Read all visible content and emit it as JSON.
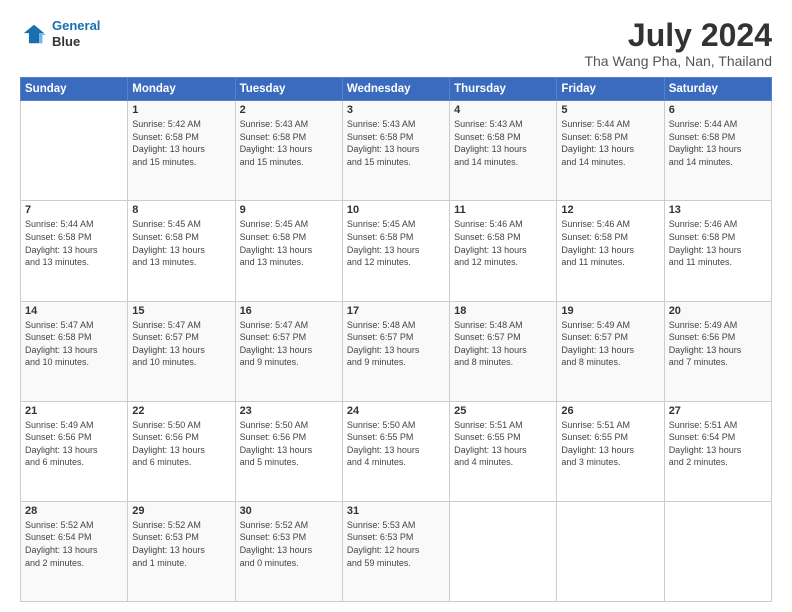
{
  "header": {
    "logo_line1": "General",
    "logo_line2": "Blue",
    "month_year": "July 2024",
    "location": "Tha Wang Pha, Nan, Thailand"
  },
  "days_of_week": [
    "Sunday",
    "Monday",
    "Tuesday",
    "Wednesday",
    "Thursday",
    "Friday",
    "Saturday"
  ],
  "weeks": [
    [
      {
        "day": "",
        "info": ""
      },
      {
        "day": "1",
        "info": "Sunrise: 5:42 AM\nSunset: 6:58 PM\nDaylight: 13 hours\nand 15 minutes."
      },
      {
        "day": "2",
        "info": "Sunrise: 5:43 AM\nSunset: 6:58 PM\nDaylight: 13 hours\nand 15 minutes."
      },
      {
        "day": "3",
        "info": "Sunrise: 5:43 AM\nSunset: 6:58 PM\nDaylight: 13 hours\nand 15 minutes."
      },
      {
        "day": "4",
        "info": "Sunrise: 5:43 AM\nSunset: 6:58 PM\nDaylight: 13 hours\nand 14 minutes."
      },
      {
        "day": "5",
        "info": "Sunrise: 5:44 AM\nSunset: 6:58 PM\nDaylight: 13 hours\nand 14 minutes."
      },
      {
        "day": "6",
        "info": "Sunrise: 5:44 AM\nSunset: 6:58 PM\nDaylight: 13 hours\nand 14 minutes."
      }
    ],
    [
      {
        "day": "7",
        "info": "Sunrise: 5:44 AM\nSunset: 6:58 PM\nDaylight: 13 hours\nand 13 minutes."
      },
      {
        "day": "8",
        "info": "Sunrise: 5:45 AM\nSunset: 6:58 PM\nDaylight: 13 hours\nand 13 minutes."
      },
      {
        "day": "9",
        "info": "Sunrise: 5:45 AM\nSunset: 6:58 PM\nDaylight: 13 hours\nand 13 minutes."
      },
      {
        "day": "10",
        "info": "Sunrise: 5:45 AM\nSunset: 6:58 PM\nDaylight: 13 hours\nand 12 minutes."
      },
      {
        "day": "11",
        "info": "Sunrise: 5:46 AM\nSunset: 6:58 PM\nDaylight: 13 hours\nand 12 minutes."
      },
      {
        "day": "12",
        "info": "Sunrise: 5:46 AM\nSunset: 6:58 PM\nDaylight: 13 hours\nand 11 minutes."
      },
      {
        "day": "13",
        "info": "Sunrise: 5:46 AM\nSunset: 6:58 PM\nDaylight: 13 hours\nand 11 minutes."
      }
    ],
    [
      {
        "day": "14",
        "info": "Sunrise: 5:47 AM\nSunset: 6:58 PM\nDaylight: 13 hours\nand 10 minutes."
      },
      {
        "day": "15",
        "info": "Sunrise: 5:47 AM\nSunset: 6:57 PM\nDaylight: 13 hours\nand 10 minutes."
      },
      {
        "day": "16",
        "info": "Sunrise: 5:47 AM\nSunset: 6:57 PM\nDaylight: 13 hours\nand 9 minutes."
      },
      {
        "day": "17",
        "info": "Sunrise: 5:48 AM\nSunset: 6:57 PM\nDaylight: 13 hours\nand 9 minutes."
      },
      {
        "day": "18",
        "info": "Sunrise: 5:48 AM\nSunset: 6:57 PM\nDaylight: 13 hours\nand 8 minutes."
      },
      {
        "day": "19",
        "info": "Sunrise: 5:49 AM\nSunset: 6:57 PM\nDaylight: 13 hours\nand 8 minutes."
      },
      {
        "day": "20",
        "info": "Sunrise: 5:49 AM\nSunset: 6:56 PM\nDaylight: 13 hours\nand 7 minutes."
      }
    ],
    [
      {
        "day": "21",
        "info": "Sunrise: 5:49 AM\nSunset: 6:56 PM\nDaylight: 13 hours\nand 6 minutes."
      },
      {
        "day": "22",
        "info": "Sunrise: 5:50 AM\nSunset: 6:56 PM\nDaylight: 13 hours\nand 6 minutes."
      },
      {
        "day": "23",
        "info": "Sunrise: 5:50 AM\nSunset: 6:56 PM\nDaylight: 13 hours\nand 5 minutes."
      },
      {
        "day": "24",
        "info": "Sunrise: 5:50 AM\nSunset: 6:55 PM\nDaylight: 13 hours\nand 4 minutes."
      },
      {
        "day": "25",
        "info": "Sunrise: 5:51 AM\nSunset: 6:55 PM\nDaylight: 13 hours\nand 4 minutes."
      },
      {
        "day": "26",
        "info": "Sunrise: 5:51 AM\nSunset: 6:55 PM\nDaylight: 13 hours\nand 3 minutes."
      },
      {
        "day": "27",
        "info": "Sunrise: 5:51 AM\nSunset: 6:54 PM\nDaylight: 13 hours\nand 2 minutes."
      }
    ],
    [
      {
        "day": "28",
        "info": "Sunrise: 5:52 AM\nSunset: 6:54 PM\nDaylight: 13 hours\nand 2 minutes."
      },
      {
        "day": "29",
        "info": "Sunrise: 5:52 AM\nSunset: 6:53 PM\nDaylight: 13 hours\nand 1 minute."
      },
      {
        "day": "30",
        "info": "Sunrise: 5:52 AM\nSunset: 6:53 PM\nDaylight: 13 hours\nand 0 minutes."
      },
      {
        "day": "31",
        "info": "Sunrise: 5:53 AM\nSunset: 6:53 PM\nDaylight: 12 hours\nand 59 minutes."
      },
      {
        "day": "",
        "info": ""
      },
      {
        "day": "",
        "info": ""
      },
      {
        "day": "",
        "info": ""
      }
    ]
  ]
}
